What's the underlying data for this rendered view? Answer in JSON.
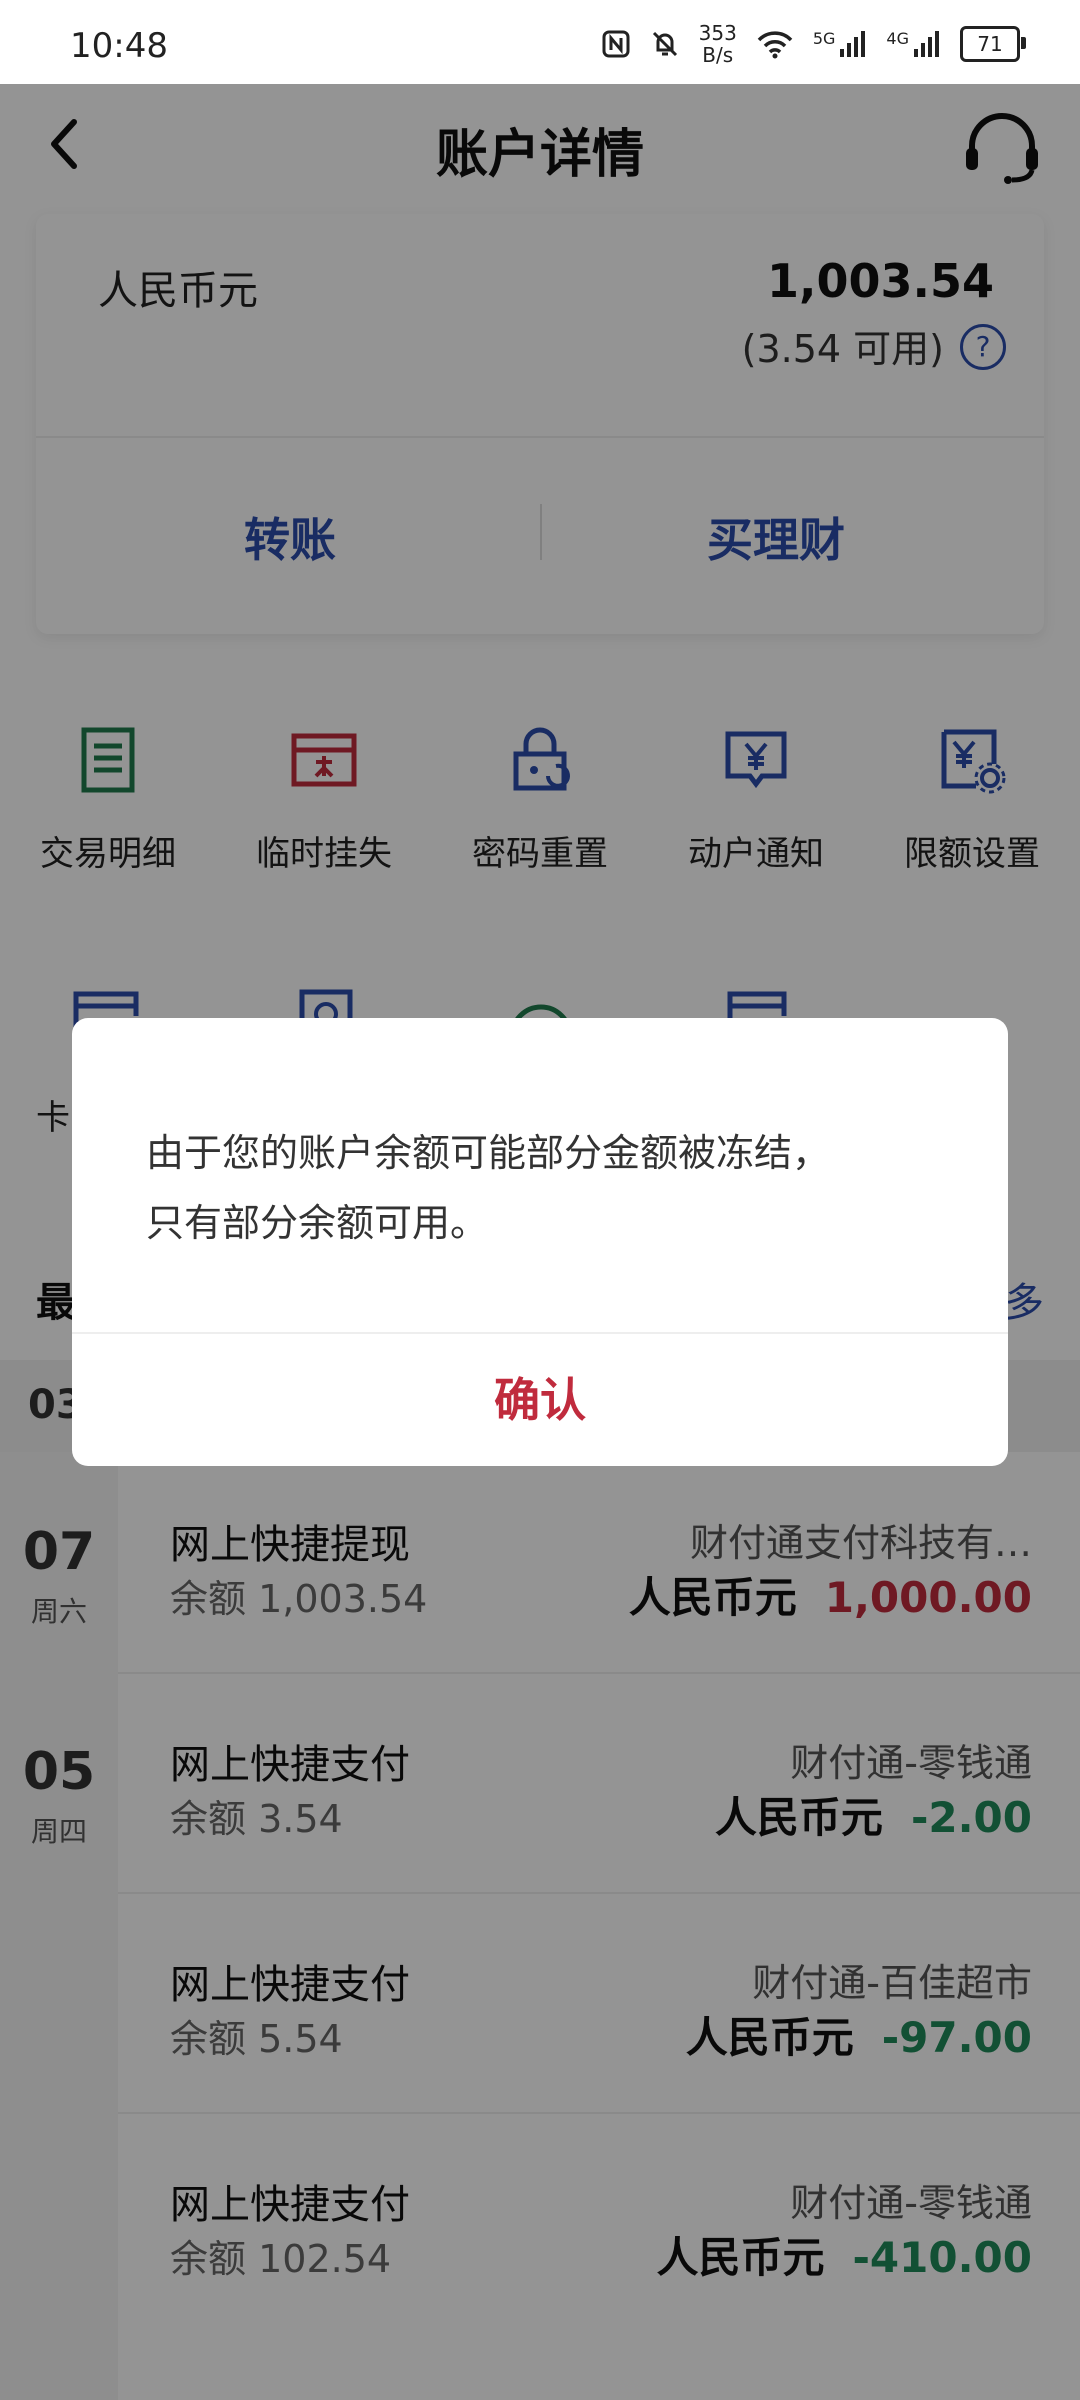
{
  "status_bar": {
    "time": "10:48",
    "net_speed_value": "353",
    "net_speed_unit": "B/s",
    "signal_1": "5G",
    "signal_2": "4G",
    "battery": "71"
  },
  "header": {
    "title": "账户详情"
  },
  "account": {
    "currency": "人民币元",
    "balance": "1,003.54",
    "available": "(3.54 可用)",
    "help_glyph": "?",
    "actions": [
      "转账",
      "买理财"
    ]
  },
  "functions": {
    "row1": [
      "交易明细",
      "临时挂失",
      "密码重置",
      "动户通知",
      "限额设置"
    ],
    "row2_partial_label": "卡"
  },
  "transactions": {
    "section_title": "最",
    "more": "多",
    "month": "03",
    "currency": "人民币元",
    "balance_prefix": "余额",
    "dates": [
      {
        "day": "07",
        "weekday": "周六"
      },
      {
        "day": "05",
        "weekday": "周四"
      }
    ],
    "items": [
      {
        "type": "网上快捷提现",
        "balance": "1,003.54",
        "merchant": "财付通支付科技有…",
        "amount": "1,000.00",
        "sign": "in"
      },
      {
        "type": "网上快捷支付",
        "balance": "3.54",
        "merchant": "财付通-零钱通",
        "amount": "-2.00",
        "sign": "out"
      },
      {
        "type": "网上快捷支付",
        "balance": "5.54",
        "merchant": "财付通-百佳超市",
        "amount": "-97.00",
        "sign": "out"
      },
      {
        "type": "网上快捷支付",
        "balance": "102.54",
        "merchant": "财付通-零钱通",
        "amount": "-410.00",
        "sign": "out"
      }
    ]
  },
  "dialog": {
    "message_line1": "由于您的账户余额可能部分金额被冻结，",
    "message_line2": "只有部分余额可用。",
    "confirm_label": "确认"
  },
  "colors": {
    "brand_blue": "#2b4dab",
    "alert_red": "#c02b3d",
    "income_green": "#1f8a5b",
    "icon_green": "#1f7a4d"
  }
}
